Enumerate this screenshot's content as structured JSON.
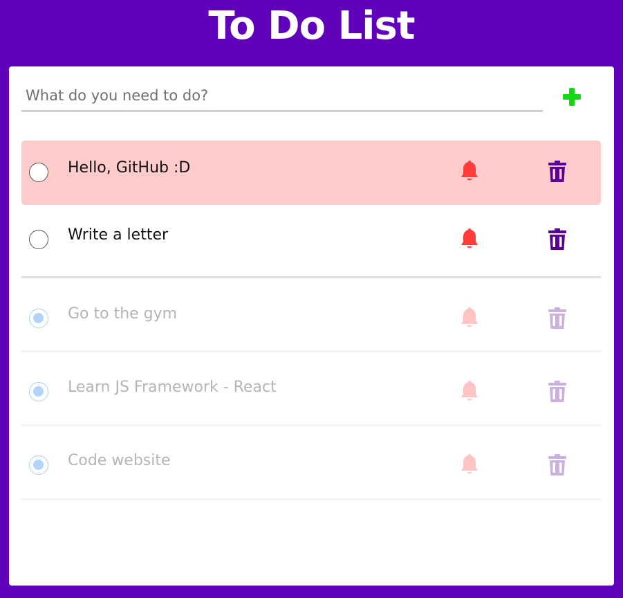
{
  "app": {
    "title": "To Do List"
  },
  "new_task": {
    "placeholder": "What do you need to do?",
    "add_icon": "plus-icon"
  },
  "colors": {
    "background": "#6002b9",
    "card": "#ffffff",
    "highlight_row": "#ffcccb",
    "add_icon": "#18d718",
    "bell": "#ff3b3b",
    "trash": "#5a0094",
    "done_check": "#b3d4f9"
  },
  "tasks": [
    {
      "label": "Hello, GitHub :D",
      "done": false,
      "highlighted": true
    },
    {
      "label": "Write a letter",
      "done": false,
      "highlighted": false
    },
    {
      "label": "Go to the gym",
      "done": true,
      "highlighted": false
    },
    {
      "label": "Learn JS Framework - React",
      "done": true,
      "highlighted": false
    },
    {
      "label": "Code website",
      "done": true,
      "highlighted": false
    }
  ]
}
